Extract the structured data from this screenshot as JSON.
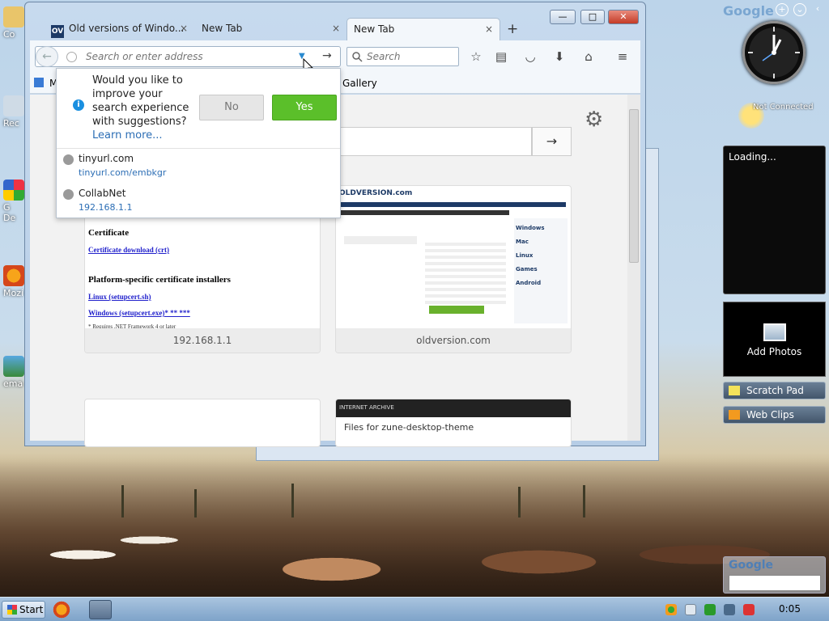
{
  "desktop": {
    "icons": [
      {
        "label": "Co"
      },
      {
        "label": "Rec"
      },
      {
        "label": "G\nDe"
      },
      {
        "label": "Mozi"
      },
      {
        "label": "ema"
      }
    ]
  },
  "gadgets": {
    "google_logo": "Google",
    "weather_status": "Not Connected",
    "slideshow_status": "Loading...",
    "photos_label": "Add Photos",
    "scratch_pad": "Scratch Pad",
    "web_clips": "Web Clips",
    "google_search_logo": "Google"
  },
  "taskbar": {
    "start_label": "Start",
    "clock": "0:05"
  },
  "browser": {
    "tabs": [
      {
        "favicon_text": "OV",
        "label": "Old versions of Windo...",
        "close": "×"
      },
      {
        "label": "New Tab",
        "close": "×"
      },
      {
        "label": "New Tab",
        "close": "×",
        "active": true
      }
    ],
    "new_tab": "+",
    "window_controls": {
      "minimize": "—",
      "maximize": "□",
      "close": "✕"
    },
    "url_placeholder": "Search or enter address",
    "search_placeholder": "Search",
    "bookmarks": [
      {
        "label": "M"
      },
      {
        "label": "Gallery"
      }
    ]
  },
  "popup": {
    "question": "Would you like to improve your search experience with suggestions?",
    "learn_more": "Learn more...",
    "no_label": "No",
    "yes_label": "Yes",
    "suggestions": [
      {
        "title": "tinyurl.com",
        "url": "tinyurl.com/embkgr"
      },
      {
        "title": "CollabNet",
        "url": "192.168.1.1"
      }
    ]
  },
  "newtab": {
    "go_arrow": "→",
    "tiles": [
      {
        "caption": "192.168.1.1",
        "heading1": "Certificate",
        "link1": "Certificate download (crt)",
        "heading2": "Platform-specific certificate installers",
        "link2": "Linux (setupcert.sh)",
        "link3": "Windows (setupcert.exe)* ** ***",
        "footnote": "* Requires .NET Framework 4 or later"
      },
      {
        "caption": "oldversion.com",
        "logo": "OLDVERSION.com",
        "nav": [
          "Windows",
          "Mac",
          "Linux",
          "Games",
          "Android"
        ]
      },
      {
        "caption": ""
      },
      {
        "caption": "",
        "text": "Files for zune-desktop-theme",
        "header": "INTERNET ARCHIVE"
      }
    ]
  },
  "colors": {
    "accent_yes": "#5bbf2a",
    "link": "#2c6eb5",
    "info": "#1a8fe0",
    "close_button": "#c43b26"
  }
}
